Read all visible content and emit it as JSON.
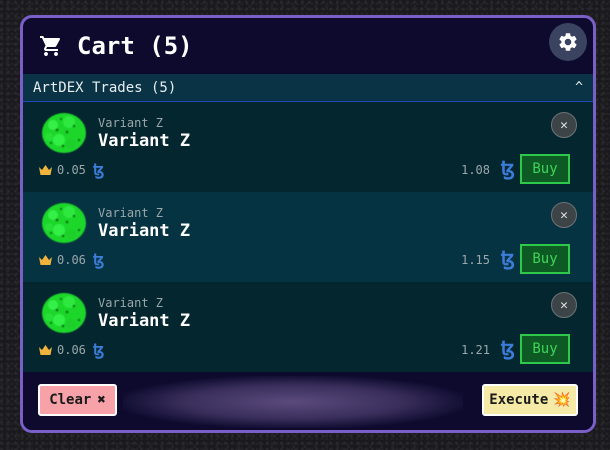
{
  "header": {
    "title": "Cart (5)",
    "cart_icon": "cart-icon",
    "settings_icon": "gear-icon"
  },
  "section": {
    "title": "ArtDEX Trades (5)",
    "toggle_icon": "chevron-up-icon",
    "toggle_glyph": "^"
  },
  "items": [
    {
      "subtitle": "Variant Z",
      "name": "Variant Z",
      "royalty": "0.05",
      "price": "1.08",
      "currency_glyph": "ꜩ",
      "buy_label": "Buy",
      "remove_glyph": "✕"
    },
    {
      "subtitle": "Variant Z",
      "name": "Variant Z",
      "royalty": "0.06",
      "price": "1.15",
      "currency_glyph": "ꜩ",
      "buy_label": "Buy",
      "remove_glyph": "✕"
    },
    {
      "subtitle": "Variant Z",
      "name": "Variant Z",
      "royalty": "0.06",
      "price": "1.21",
      "currency_glyph": "ꜩ",
      "buy_label": "Buy",
      "remove_glyph": "✕"
    }
  ],
  "footer": {
    "clear_label": "Clear",
    "clear_glyph": "✖",
    "execute_label": "Execute",
    "execute_glyph": "💥"
  },
  "colors": {
    "panel_bg": "#0d0a2e",
    "panel_border": "#7b5fc9",
    "buy_green": "#2ec94a",
    "tez_blue": "#3b7dd8",
    "clear_bg": "#f7a1a8",
    "execute_bg": "#f5eba6"
  }
}
